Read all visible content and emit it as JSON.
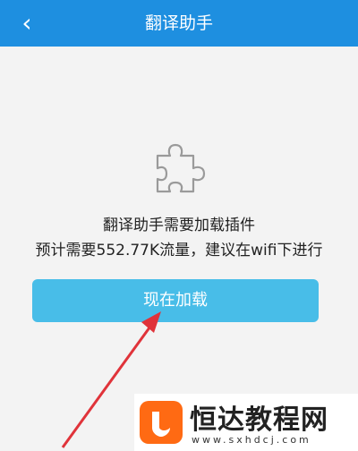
{
  "header": {
    "back_icon": "back-chevron-icon",
    "title": "翻译助手"
  },
  "content": {
    "plugin_icon": "puzzle-piece-icon",
    "message_line1": "翻译助手需要加载插件",
    "message_line2": "预计需要552.77K流量，建议在wifi下进行",
    "load_button_label": "现在加载"
  },
  "watermark": {
    "brand": "恒达教程网",
    "domain": "www.sxhdcj.com"
  },
  "colors": {
    "header_bg": "#1e8fe0",
    "button_bg": "#48bde8",
    "arrow": "#e0333a",
    "logo": "#ff6a13"
  }
}
